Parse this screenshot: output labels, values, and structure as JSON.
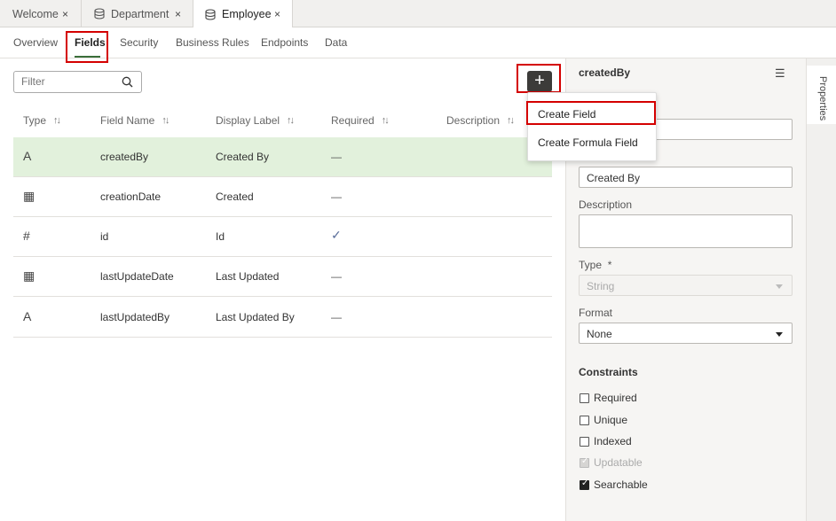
{
  "tabs": [
    {
      "label": "Welcome",
      "close": "×"
    },
    {
      "label": "Department",
      "close": "×"
    },
    {
      "label": "Employee",
      "close": "×"
    }
  ],
  "subtabs": [
    "Overview",
    "Fields",
    "Security",
    "Business Rules",
    "Endpoints",
    "Data"
  ],
  "filter": {
    "placeholder": "Filter"
  },
  "add_button": "+",
  "columns": [
    "Type",
    "Field Name",
    "Display Label",
    "Required",
    "Description"
  ],
  "rows": [
    {
      "type_icon": "string-type-icon",
      "type_glyph": "A",
      "name": "createdBy",
      "label": "Created By",
      "required": "—"
    },
    {
      "type_icon": "datetime-type-icon",
      "type_glyph": "▦",
      "name": "creationDate",
      "label": "Created",
      "required": "—"
    },
    {
      "type_icon": "number-type-icon",
      "type_glyph": "#",
      "name": "id",
      "label": "Id",
      "required": "✓"
    },
    {
      "type_icon": "datetime-type-icon",
      "type_glyph": "▦",
      "name": "lastUpdateDate",
      "label": "Last Updated",
      "required": "—"
    },
    {
      "type_icon": "string-type-icon",
      "type_glyph": "A",
      "name": "lastUpdatedBy",
      "label": "Last Updated By",
      "required": "—"
    }
  ],
  "menu": {
    "items": [
      "Create Field",
      "Create Formula Field"
    ]
  },
  "properties": {
    "title": "createdBy",
    "display_label_value": "Created By",
    "description_label": "Description",
    "type_label": "Type",
    "type_required_mark": "*",
    "type_value": "String",
    "format_label": "Format",
    "format_value": "None",
    "constraints_title": "Constraints",
    "constraints": [
      {
        "label": "Required",
        "checked": false,
        "disabled": false
      },
      {
        "label": "Unique",
        "checked": false,
        "disabled": false
      },
      {
        "label": "Indexed",
        "checked": false,
        "disabled": false
      },
      {
        "label": "Updatable",
        "checked": true,
        "disabled": true
      },
      {
        "label": "Searchable",
        "checked": true,
        "disabled": false
      }
    ]
  },
  "rail": {
    "label": "Properties"
  },
  "colors": {
    "selected_row": "#e2f1dc",
    "highlight": "#d40000",
    "active_underline": "#3a6e3a"
  }
}
